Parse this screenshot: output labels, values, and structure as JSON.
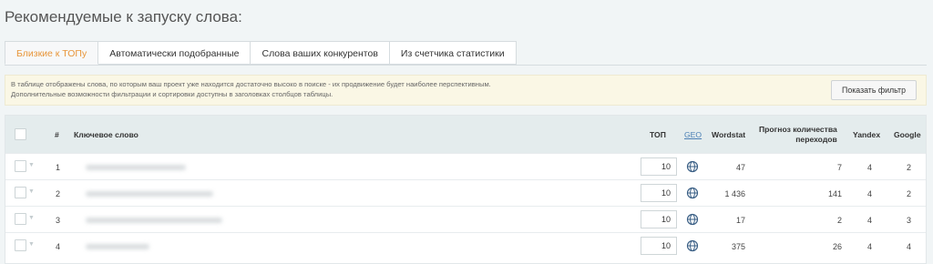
{
  "page": {
    "title": "Рекомендуемые к запуску слова:"
  },
  "tabs": [
    {
      "label": "Близкие к ТОПу",
      "active": true
    },
    {
      "label": "Автоматически подобранные",
      "active": false
    },
    {
      "label": "Слова ваших конкурентов",
      "active": false
    },
    {
      "label": "Из счетчика статистики",
      "active": false
    }
  ],
  "info": {
    "line1": "В таблице отображены слова, по которым ваш проект уже находится достаточно высоко в поиске - их продвижение будет наиболее перспективным.",
    "line2": "Дополнительные возможности фильтрации и сортировки доступны в заголовках столбцов таблицы.",
    "filter_button": "Показать фильтр"
  },
  "table": {
    "headers": {
      "num": "#",
      "keyword": "Ключевое слово",
      "top": "ТОП",
      "geo": "GEO",
      "wordstat": "Wordstat",
      "forecast_line1": "Прогноз количества",
      "forecast_line2": "переходов",
      "yandex": "Yandex",
      "google": "Google"
    },
    "rows": [
      {
        "num": "1",
        "top": "10",
        "wordstat": "47",
        "forecast": "7",
        "yandex": "4",
        "google": "2"
      },
      {
        "num": "2",
        "top": "10",
        "wordstat": "1 436",
        "forecast": "141",
        "yandex": "4",
        "google": "2"
      },
      {
        "num": "3",
        "top": "10",
        "wordstat": "17",
        "forecast": "2",
        "yandex": "4",
        "google": "3"
      },
      {
        "num": "4",
        "top": "10",
        "wordstat": "375",
        "forecast": "26",
        "yandex": "4",
        "google": "4"
      }
    ]
  },
  "colors": {
    "accent": "#e8963a",
    "header_bg": "#e4eced",
    "info_bg": "#faf7e5"
  }
}
